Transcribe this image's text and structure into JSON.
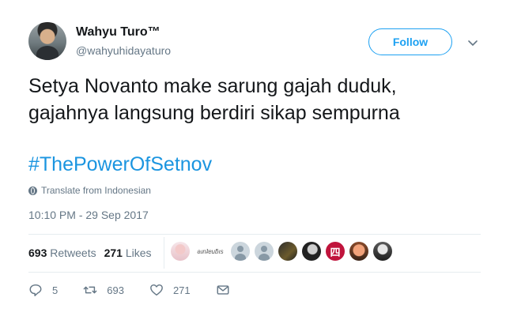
{
  "author": {
    "name": "Wahyu Turo™",
    "handle": "@wahyuhidayaturo"
  },
  "follow_label": "Follow",
  "tweet": {
    "lines": [
      "Setya Novanto make sarung gajah duduk,",
      "gajahnya langsung berdiri sikap sempurna"
    ],
    "hashtag": "#ThePowerOfSetnov",
    "translate_label": "Translate from Indonesian",
    "timestamp": "10:10 PM - 29 Sep 2017"
  },
  "stats": {
    "retweets_count": "693",
    "retweets_label": "Retweets",
    "likes_count": "271",
    "likes_label": "Likes"
  },
  "likers": {
    "signature_text": "ǝɹnʇɐuƃıs",
    "kanji_badge": "四",
    "count_shown": 10
  },
  "actions": {
    "reply_count": "5",
    "retweet_count": "693",
    "like_count": "271"
  },
  "colors": {
    "accent": "#1da1f2",
    "hashtag": "#1b95e0",
    "muted": "#657786",
    "text": "#14171a",
    "divider": "#e6ecf0"
  }
}
